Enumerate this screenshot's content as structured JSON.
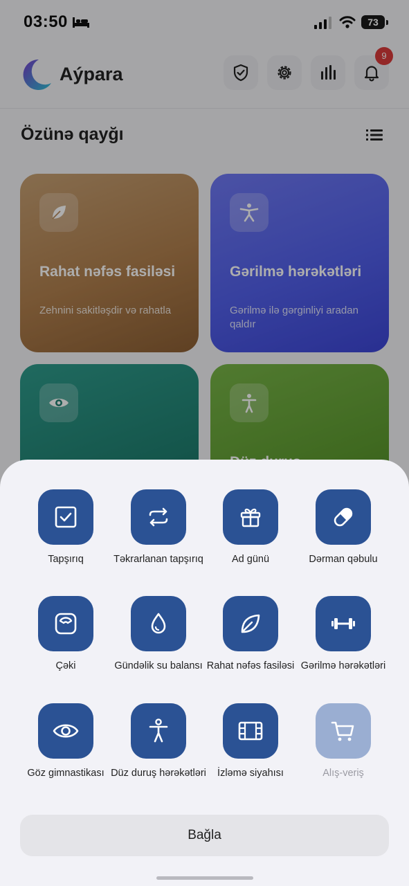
{
  "status_bar": {
    "time": "03:50",
    "battery": "73"
  },
  "app": {
    "title": "Aýpara",
    "notifications_count": "9"
  },
  "section": {
    "title": "Özünə qayğı"
  },
  "cards": [
    {
      "title": "Rahat nəfəs fasiləsi",
      "subtitle": "Zehnini sakitləşdir və rahatla"
    },
    {
      "title": "Gərilmə hərəkətləri",
      "subtitle": "Gərilmə ilə gərginliyi aradan qaldır"
    },
    {
      "title": "",
      "subtitle": ""
    },
    {
      "title": "Düz duruş",
      "subtitle": ""
    }
  ],
  "sheet": {
    "items": [
      {
        "label": "Tapşırıq",
        "icon": "checkbox-icon"
      },
      {
        "label": "Təkrarlanan tapşırıq",
        "icon": "repeat-icon"
      },
      {
        "label": "Ad günü",
        "icon": "gift-icon"
      },
      {
        "label": "Dərman qəbulu",
        "icon": "pill-icon"
      },
      {
        "label": "Çəki",
        "icon": "scale-icon"
      },
      {
        "label": "Gündəlik su balansı",
        "icon": "water-drop-icon"
      },
      {
        "label": "Rahat nəfəs fasiləsi",
        "icon": "leaf-icon"
      },
      {
        "label": "Gərilmə hərəkətləri",
        "icon": "dumbbell-icon"
      },
      {
        "label": "Göz gimnastikası",
        "icon": "eye-icon"
      },
      {
        "label": "Düz duruş hərəkətləri",
        "icon": "person-icon"
      },
      {
        "label": "İzləmə siyahısı",
        "icon": "film-icon"
      },
      {
        "label": "Alış-veriş",
        "icon": "cart-icon"
      }
    ],
    "close_label": "Bağla"
  },
  "colors": {
    "item_blue": "#2b5294",
    "item_disabled": "#9aaed2",
    "badge_red": "#d93a3a"
  }
}
